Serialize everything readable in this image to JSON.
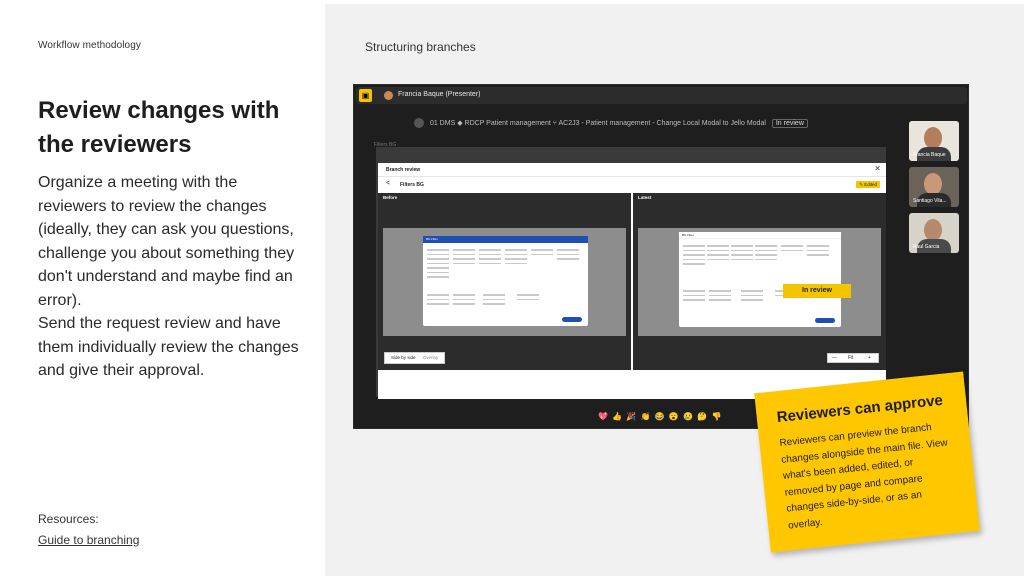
{
  "left": {
    "eyebrow": "Workflow methodology",
    "title": "Review changes with the reviewers",
    "body_p1": "Organize a meeting with the reviewers to review the changes (ideally, they can ask you questions, challenge you about something they don't understand and maybe find an error).",
    "body_p2": "Send the request review and have them individually review the changes and give their approval.",
    "resources_label": "Resources:",
    "resources_link": "Guide to branching"
  },
  "right": {
    "section_title": "Structuring branches"
  },
  "app": {
    "presenter": "Francia Baque (Presenter)",
    "breadcrumb": {
      "team": "01 DMS",
      "project": "RDCP Patient management",
      "file": "AC2J3 - Patient management - Change Local Modal to Jello Modal",
      "status_chip": "In review"
    },
    "canvas_label": "Filters BG",
    "modal": {
      "title": "Branch review",
      "close_glyph": "✕",
      "back_glyph": "<",
      "subtitle": "Filters BG",
      "edited_badge": "✎ Edited",
      "before_label": "Before",
      "latest_label": "Latest",
      "mini_before_header": "BG Filter",
      "mini_latest_header": "BG Filter",
      "toggle_side": "Side by side",
      "toggle_overlay": "Overlay",
      "zoom_minus": "—",
      "zoom_fit": "Fit",
      "zoom_plus": "+"
    },
    "in_review_tag": "In review",
    "reactions": "💖 👍 🎉 👏 😂 😮 😢 🤔 👎",
    "participants": [
      {
        "name": "Francia Baque"
      },
      {
        "name": "Santiago Vila..."
      },
      {
        "name": "Raul Garcia"
      }
    ]
  },
  "sticky": {
    "title": "Reviewers can approve",
    "body": "Reviewers can preview the branch changes alongside the main file. View what's been added, edited, or removed by page and compare changes side-by-side, or as an overlay."
  },
  "colors": {
    "accent_yellow": "#ffc700",
    "figma_blue": "#1f4fb5",
    "app_dark": "#1e1e1e",
    "panel_bg": "#f1f1f1"
  }
}
